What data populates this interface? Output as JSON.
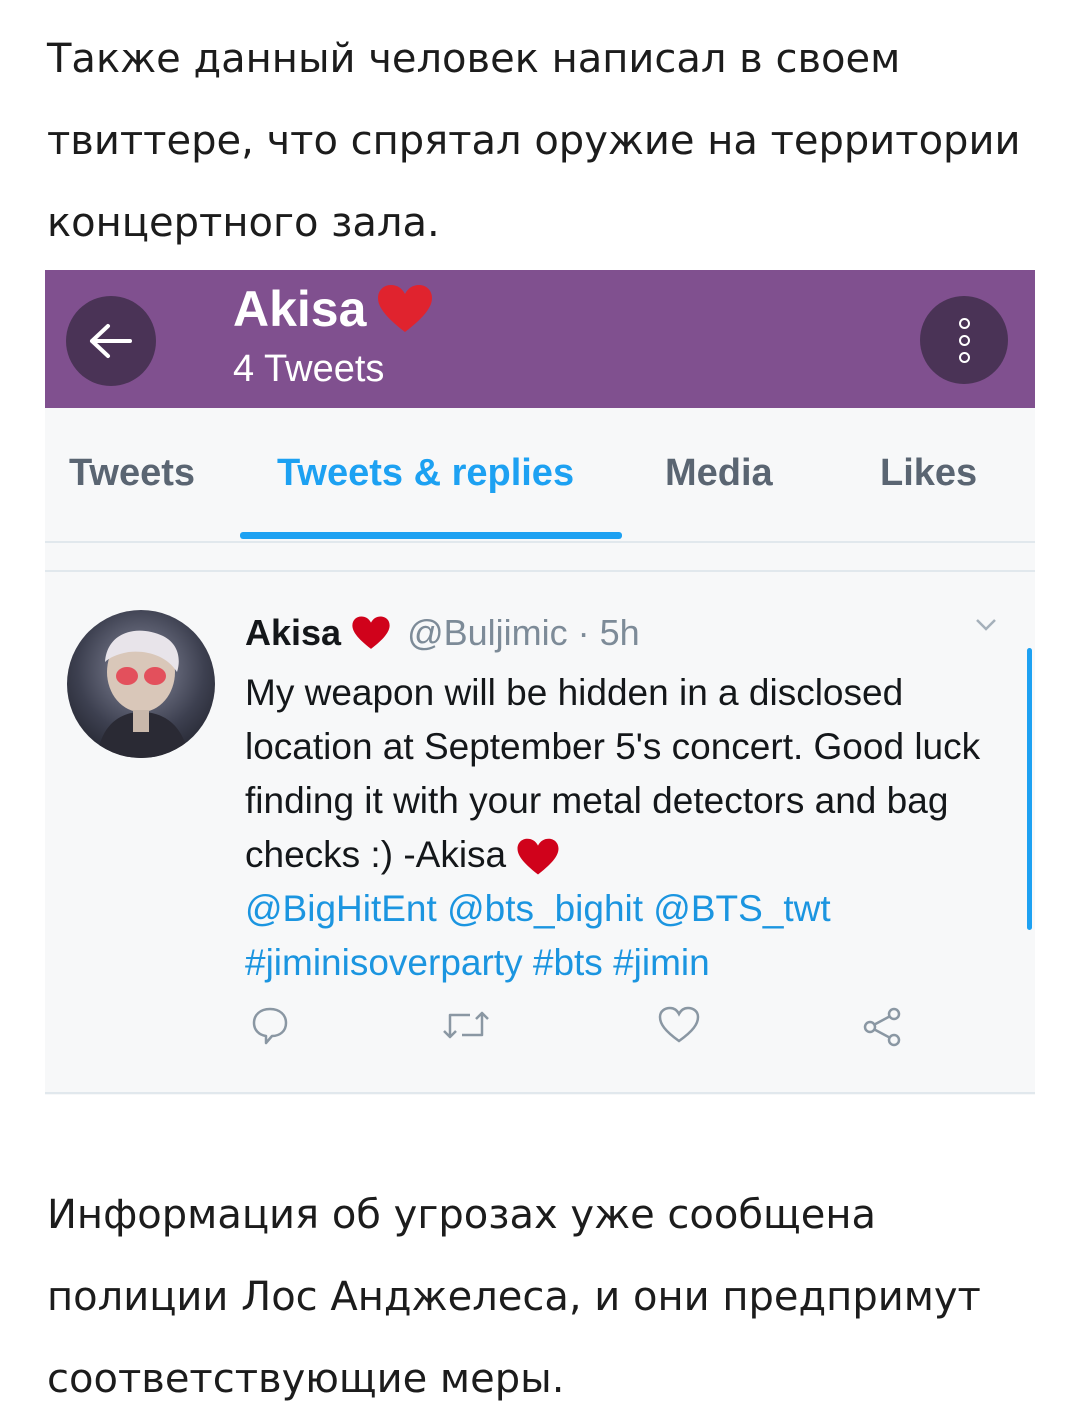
{
  "article": {
    "top_text": "Также данный человек написал в своем твиттере, что спрятал оружие на территории концертного зала.",
    "bottom_text": "Информация об угрозах уже сообщена полиции Лос Анджелеса, и они предпримут соответствующие меры."
  },
  "profile_header": {
    "name": "Akisa",
    "tweet_count": "4 Tweets",
    "background_color": "#80508f",
    "back_icon": "arrow-left-icon",
    "menu_icon": "more-vertical-icon"
  },
  "tabs": [
    {
      "label": "Tweets",
      "active": false
    },
    {
      "label": "Tweets & replies",
      "active": true
    },
    {
      "label": "Media",
      "active": false
    },
    {
      "label": "Likes",
      "active": false
    }
  ],
  "tweet": {
    "author_name": "Akisa",
    "handle": "@Buljimic · 5h",
    "body": "My weapon will be hidden in a disclosed location at September 5's concert. Good luck finding it with your metal detectors and bag checks :) -Akisa",
    "mentions": "@BigHitEnt @bts_bighit @BTS_twt",
    "hashtags": "#jiminisoverparty #bts #jimin"
  },
  "colors": {
    "accent": "#1da1f2",
    "heart": "#d0021b"
  }
}
